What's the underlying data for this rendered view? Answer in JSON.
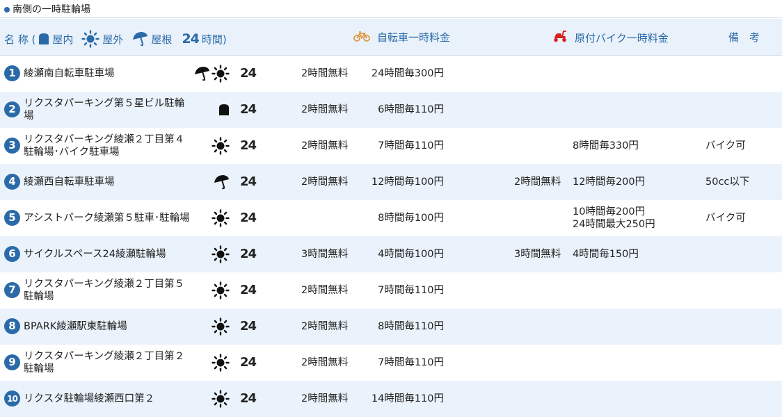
{
  "title": "南側の一時駐輪場",
  "header": {
    "name_label": "名 称 (",
    "indoor_label": "屋内",
    "outdoor_label": "屋外",
    "roof_label": "屋根",
    "hours_num": "24",
    "hours_label": "時間)",
    "bike_label": "自転車一時料金",
    "moto_label": "原付バイク一時料金",
    "remarks_label": "備　考"
  },
  "colors": {
    "accent": "#2a6aa8",
    "row_alt": "#eaf2fb",
    "header_bg": "#e9f1fa",
    "bike_icon": "#e09030",
    "moto_icon": "#d92020"
  },
  "rows": [
    {
      "num": "1",
      "name": "綾瀬南自転車駐車場",
      "icons": [
        "umbrella-icon",
        "sun-icon"
      ],
      "hours": "24",
      "bike_free": "2時間無料",
      "bike_rate": "24時間毎300円",
      "moto_free": "",
      "moto_rate": [
        "",
        ""
      ],
      "remarks": ""
    },
    {
      "num": "2",
      "name": "リクスタパーキング第５星ビル駐輪場",
      "icons": [
        "indoor-icon"
      ],
      "hours": "24",
      "bike_free": "2時間無料",
      "bike_rate": "6時間毎110円",
      "moto_free": "",
      "moto_rate": [
        "",
        ""
      ],
      "remarks": ""
    },
    {
      "num": "3",
      "name": "リクスタパーキング綾瀬２丁目第４駐輪場･バイク駐車場",
      "icons": [
        "sun-icon"
      ],
      "hours": "24",
      "bike_free": "2時間無料",
      "bike_rate": "7時間毎110円",
      "moto_free": "",
      "moto_rate": [
        "8時間毎330円",
        ""
      ],
      "remarks": "バイク可"
    },
    {
      "num": "4",
      "name": "綾瀬西自転車駐車場",
      "icons": [
        "umbrella-icon"
      ],
      "hours": "24",
      "bike_free": "2時間無料",
      "bike_rate": "12時間毎100円",
      "moto_free": "2時間無料",
      "moto_rate": [
        "12時間毎200円",
        ""
      ],
      "remarks": "50cc以下"
    },
    {
      "num": "5",
      "name": "アシストパーク綾瀬第５駐車･駐輪場",
      "icons": [
        "sun-icon"
      ],
      "hours": "24",
      "bike_free": "",
      "bike_rate": "8時間毎100円",
      "moto_free": "",
      "moto_rate": [
        "10時間毎200円",
        "24時間最大250円"
      ],
      "remarks": "バイク可"
    },
    {
      "num": "6",
      "name": "サイクルスペース24綾瀬駐輪場",
      "icons": [
        "sun-icon"
      ],
      "hours": "24",
      "bike_free": "3時間無料",
      "bike_rate": "4時間毎100円",
      "moto_free": "3時間無料",
      "moto_rate": [
        "4時間毎150円",
        ""
      ],
      "remarks": ""
    },
    {
      "num": "7",
      "name": "リクスタパーキング綾瀬２丁目第５駐輪場",
      "icons": [
        "sun-icon"
      ],
      "hours": "24",
      "bike_free": "2時間無料",
      "bike_rate": "7時間毎110円",
      "moto_free": "",
      "moto_rate": [
        "",
        ""
      ],
      "remarks": ""
    },
    {
      "num": "8",
      "name": "BPARK綾瀬駅東駐輪場",
      "icons": [
        "sun-icon"
      ],
      "hours": "24",
      "bike_free": "2時間無料",
      "bike_rate": "8時間毎110円",
      "moto_free": "",
      "moto_rate": [
        "",
        ""
      ],
      "remarks": ""
    },
    {
      "num": "9",
      "name": "リクスタパーキング綾瀬２丁目第２駐輪場",
      "icons": [
        "sun-icon"
      ],
      "hours": "24",
      "bike_free": "2時間無料",
      "bike_rate": "7時間毎110円",
      "moto_free": "",
      "moto_rate": [
        "",
        ""
      ],
      "remarks": ""
    },
    {
      "num": "10",
      "name": "リクスタ駐輪場綾瀬西口第２",
      "icons": [
        "sun-icon"
      ],
      "hours": "24",
      "bike_free": "2時間無料",
      "bike_rate": "14時間毎110円",
      "moto_free": "",
      "moto_rate": [
        "",
        ""
      ],
      "remarks": ""
    }
  ]
}
